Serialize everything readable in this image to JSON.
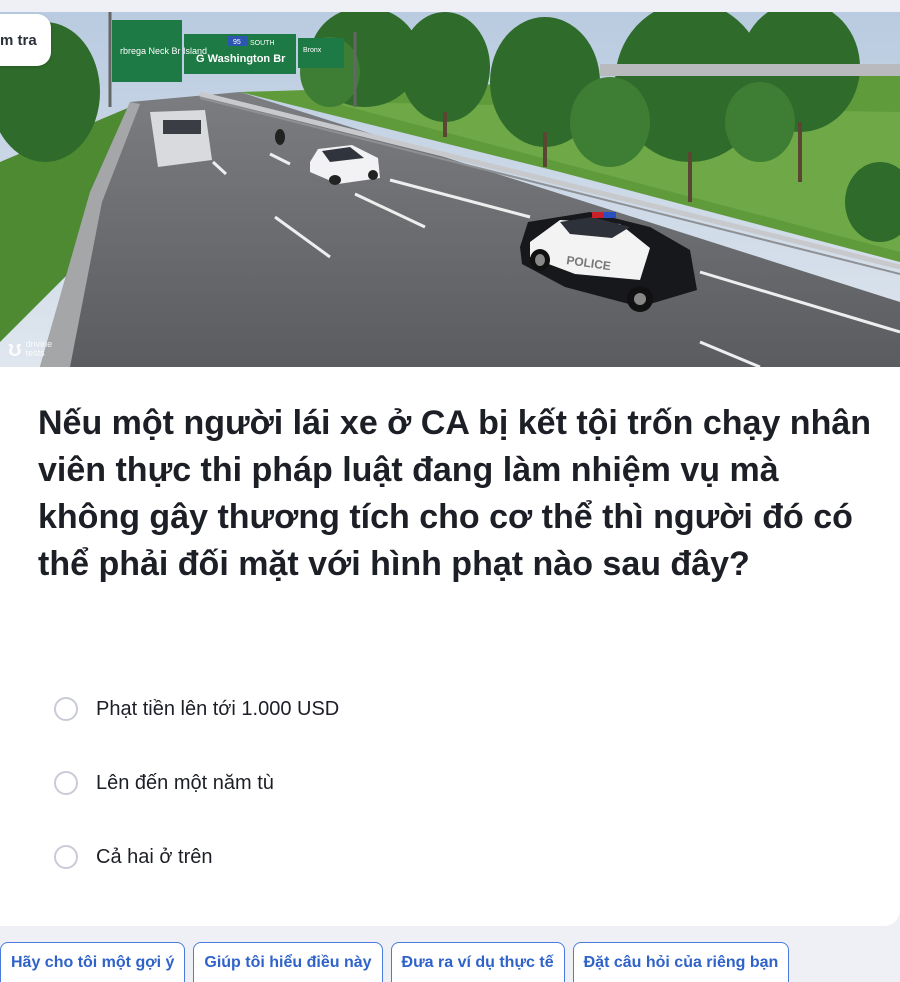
{
  "mode_tab": {
    "label": "m tra"
  },
  "scene": {
    "watermark": {
      "logo": "drivine-logo-icon",
      "text": "drivine tests"
    },
    "signs": {
      "left": "rbrega Neck Br Island",
      "middle_route": "95",
      "middle_dir": "SOUTH",
      "middle_text": "G Washington Br",
      "right_text": "Bronx"
    },
    "police_label": "POLICE"
  },
  "question": {
    "text": "Nếu một người lái xe ở CA bị kết tội trốn chạy nhân viên thực thi pháp luật đang làm nhiệm vụ mà không gây thương tích cho cơ thể thì người đó có thể phải đối mặt với hình phạt nào sau đây?"
  },
  "options": [
    {
      "label": "Phạt tiền lên tới 1.000 USD"
    },
    {
      "label": "Lên đến một năm tù"
    },
    {
      "label": "Cả hai ở trên"
    }
  ],
  "suggestions": [
    {
      "label": "Hãy cho tôi một gợi ý"
    },
    {
      "label": "Giúp tôi hiểu điều này"
    },
    {
      "label": "Đưa ra ví dụ thực tế"
    },
    {
      "label": "Đặt câu hỏi của riêng bạn"
    }
  ],
  "colors": {
    "accent": "#2f63c9",
    "background": "#eef0f5"
  }
}
